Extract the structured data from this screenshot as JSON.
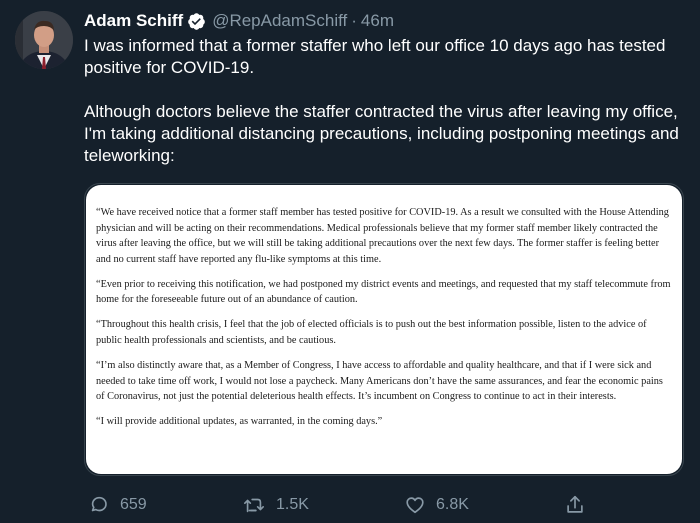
{
  "tweet": {
    "author_name": "Adam Schiff",
    "handle": "@RepAdamSchiff",
    "separator": "·",
    "timestamp": "46m",
    "icons": {
      "verified": "verified-badge-icon",
      "avatar": "avatar"
    },
    "paragraphs": [
      "I was informed that a former staffer who left our office 10 days ago has tested positive for COVID-19.",
      "Although doctors believe the staffer contracted the virus after leaving my office, I'm taking additional distancing precautions, including postponing meetings and teleworking:"
    ]
  },
  "statement": {
    "paragraphs": [
      "“We have received notice that a former staff member has tested positive for COVID-19. As a result we consulted with the House Attending physician and will be acting on their recommendations. Medical professionals believe that my former staff member likely contracted the virus after leaving the office, but we will still be taking additional precautions over the next few days. The former staffer is feeling better and no current staff have reported any flu-like symptoms at this time.",
      "“Even prior to receiving this notification, we had postponed my district events and meetings, and requested that my staff telecommute from home for the foreseeable future out of an abundance of caution.",
      "“Throughout this health crisis, I feel that the job of elected officials is to push out the best information possible, listen to the advice of public health professionals and scientists, and be cautious.",
      "“I’m also distinctly aware that, as a Member of Congress, I have access to affordable and quality healthcare, and that if I were sick and needed to take time off work, I would not lose a paycheck. Many Americans don’t have the same assurances, and fear the economic pains of Coronavirus, not just the potential deleterious health effects. It’s incumbent on Congress to continue to act in their interests.",
      "“I will provide additional updates, as warranted, in the coming days.”"
    ]
  },
  "actions": {
    "reply_count": "659",
    "retweet_count": "1.5K",
    "like_count": "6.8K",
    "icons": [
      "reply-icon",
      "retweet-icon",
      "like-icon",
      "share-icon"
    ]
  },
  "colors": {
    "background": "#15202b",
    "text": "#ffffff",
    "secondary_text": "#8899a6",
    "verified_badge": "#ffffff"
  }
}
